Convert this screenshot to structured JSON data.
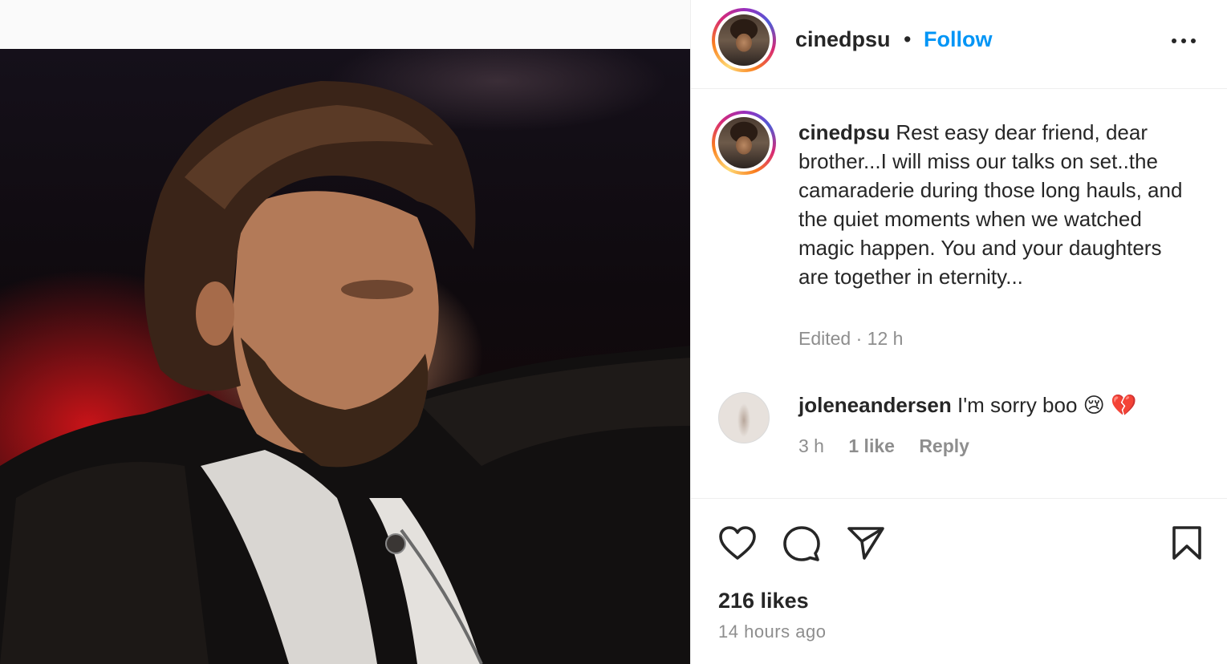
{
  "post": {
    "username": "cinedpsu",
    "dot": "•",
    "follow_label": "Follow",
    "more_icon": "more-horizontal-icon"
  },
  "caption": {
    "username": "cinedpsu",
    "text": "Rest easy dear friend, dear brother...I will miss our talks on set..the camaraderie during those long hauls, and the quiet moments when we watched magic happen. You and your daughters are together in eternity...",
    "meta": "Edited · 12 h"
  },
  "comment": {
    "username": "joleneandersen",
    "text": "I'm sorry boo 😢 💔",
    "time": "3 h",
    "likes": "1 like",
    "reply_label": "Reply"
  },
  "actions": {
    "like_icon": "heart-icon",
    "comment_icon": "comment-icon",
    "share_icon": "share-icon",
    "save_icon": "bookmark-icon"
  },
  "stats": {
    "likes": "216 likes",
    "posted": "14 hours ago"
  },
  "colors": {
    "accent": "#0095f6",
    "muted": "#8e8e8e",
    "text": "#262626"
  }
}
